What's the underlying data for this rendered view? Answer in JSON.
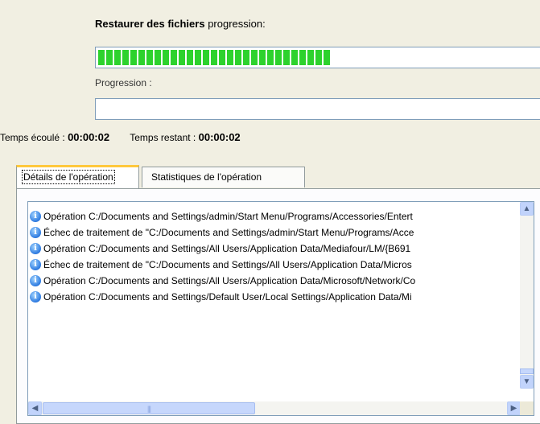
{
  "restore": {
    "title_bold": "Restaurer des fichiers",
    "title_rest": " progression:",
    "progress_fraction": 0.53,
    "progress_label": "Progression :",
    "progress2_fraction": 0.0
  },
  "timing": {
    "elapsed_label": "Temps écoulé :",
    "elapsed_value": "00:00:02",
    "remaining_label": "Temps restant :",
    "remaining_value": "00:00:02"
  },
  "tabs": [
    {
      "label": "Détails de l'opération",
      "active": true
    },
    {
      "label": "Statistiques de l'opération",
      "active": false
    }
  ],
  "log": [
    "Opération C:/Documents and Settings/admin/Start Menu/Programs/Accessories/Entert",
    "Échec de traitement de \"C:/Documents and Settings/admin/Start Menu/Programs/Acce",
    "Opération C:/Documents and Settings/All Users/Application Data/Mediafour/LM/{B691",
    "Échec de traitement de \"C:/Documents and Settings/All Users/Application Data/Micros",
    "Opération C:/Documents and Settings/All Users/Application Data/Microsoft/Network/Co",
    "Opération C:/Documents and Settings/Default User/Local Settings/Application Data/Mi"
  ],
  "icons": {
    "log_item": "info-icon",
    "scroll_up": "arrow-up-icon",
    "scroll_down": "arrow-down-icon",
    "scroll_left": "arrow-left-icon",
    "scroll_right": "arrow-right-icon"
  },
  "colors": {
    "progress_fill": "#2dd22d",
    "active_tab_accent": "#ffc83c"
  }
}
